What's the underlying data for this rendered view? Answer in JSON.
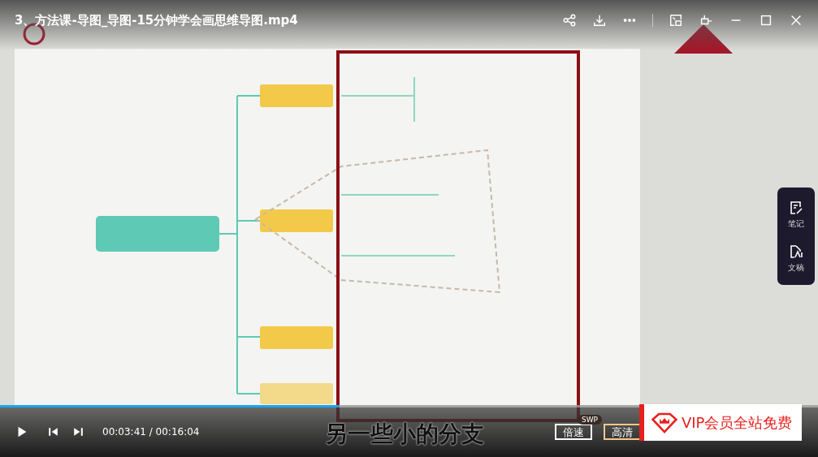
{
  "window": {
    "title": "3、方法课-导图_导图-15分钟学会画思维导图.mp4"
  },
  "video": {
    "kind": "picture",
    "subtitle": "另一些小的分支"
  },
  "side_panel": {
    "items": [
      {
        "label": "笔记"
      },
      {
        "label": "文稿"
      }
    ]
  },
  "player": {
    "progress": {
      "level": 0.415
    },
    "time": "00:03:41 / 00:16:04",
    "speed_button": "倍速",
    "speed_badge": "SWP",
    "quality_button": "高清"
  },
  "promo": {
    "text": "VIP会员全站免费"
  }
}
